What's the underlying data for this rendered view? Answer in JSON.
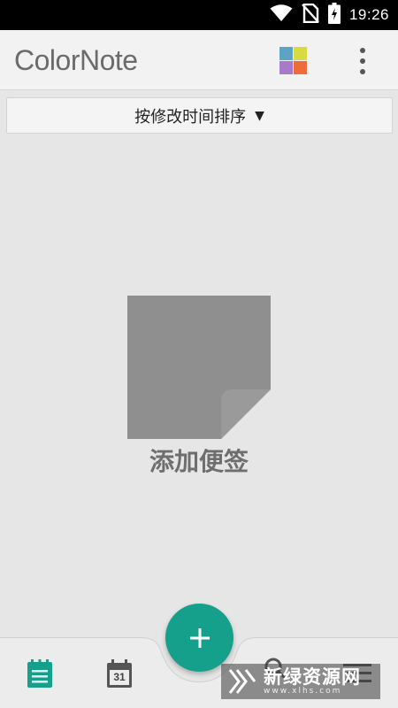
{
  "status_bar": {
    "time": "19:26",
    "icons": [
      "wifi-icon",
      "no-sim-icon",
      "battery-charging-icon"
    ]
  },
  "app_bar": {
    "logo_text": "ColorNote",
    "palette_colors": [
      "#5ba3c7",
      "#d9d940",
      "#a77bc9",
      "#ee6b3a"
    ],
    "actions": [
      "color-palette-icon",
      "more-options-icon"
    ]
  },
  "sort": {
    "label": "按修改时间排序",
    "arrow": "▼"
  },
  "empty_state": {
    "label": "添加便签",
    "icon": "note-icon"
  },
  "bottom_nav": {
    "items": [
      "notes-list-icon",
      "calendar-icon",
      "search-icon",
      "menu-icon"
    ],
    "calendar_day": "31",
    "accent": "#15a08c"
  },
  "fab": {
    "label": "+"
  },
  "watermark": {
    "title": "新绿资源网",
    "subtitle": "www.xlhs.com"
  }
}
